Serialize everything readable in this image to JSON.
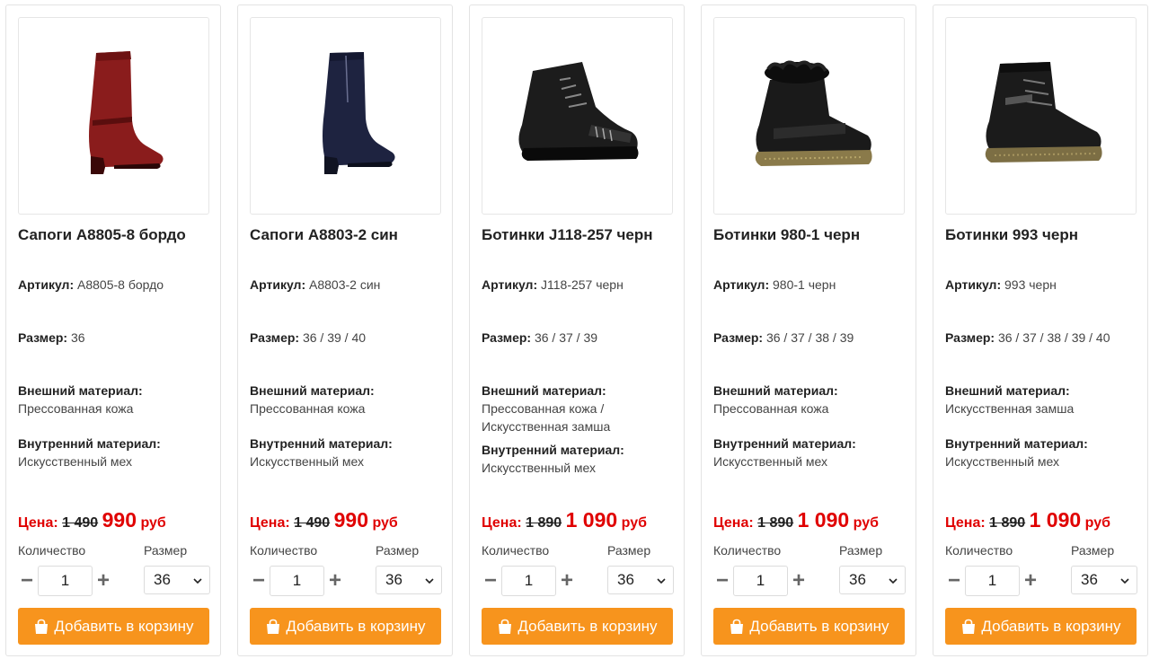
{
  "labels": {
    "article": "Артикул:",
    "size": "Размер:",
    "outer": "Внешний материал:",
    "inner": "Внутренний материал:",
    "price": "Цена:",
    "currency": "руб",
    "qty_label": "Количество",
    "size_label": "Размер",
    "add_to_cart": "Добавить в корзину",
    "minus": "−",
    "plus": "+"
  },
  "colors": {
    "accent": "#f7941d",
    "price_red": "#e00000"
  },
  "products": [
    {
      "title": "Сапоги А8805-8 бордо",
      "article": "А8805-8 бордо",
      "sizes": "36",
      "outer": "Прессованная кожа",
      "inner": "Искусственный мех",
      "old_price": "1 490",
      "new_price": "990",
      "qty": "1",
      "size_selected": "36",
      "image": "burgundy-boot"
    },
    {
      "title": "Сапоги А8803-2 син",
      "article": "А8803-2 син",
      "sizes": "36 / 39 / 40",
      "outer": "Прессованная кожа",
      "inner": "Искусственный мех",
      "old_price": "1 490",
      "new_price": "990",
      "qty": "1",
      "size_selected": "36",
      "image": "navy-boot"
    },
    {
      "title": "Ботинки J118-257 черн",
      "article": "J118-257 черн",
      "sizes": "36 / 37 / 39",
      "outer": "Прессованная кожа / Искусственная замша",
      "inner": "Искусственный мех",
      "old_price": "1 890",
      "new_price": "1 090",
      "qty": "1",
      "size_selected": "36",
      "image": "black-lace-boot"
    },
    {
      "title": "Ботинки 980-1 черн",
      "article": "980-1 черн",
      "sizes": "36 / 37 / 38 / 39",
      "outer": "Прессованная кожа",
      "inner": "Искусственный мех",
      "old_price": "1 890",
      "new_price": "1 090",
      "qty": "1",
      "size_selected": "36",
      "image": "black-fur-boot"
    },
    {
      "title": "Ботинки 993 черн",
      "article": "993 черн",
      "sizes": "36 / 37 / 38 / 39 / 40",
      "outer": "Искусственная замша",
      "inner": "Искусственный мех",
      "old_price": "1 890",
      "new_price": "1 090",
      "qty": "1",
      "size_selected": "36",
      "image": "black-suede-boot"
    }
  ]
}
